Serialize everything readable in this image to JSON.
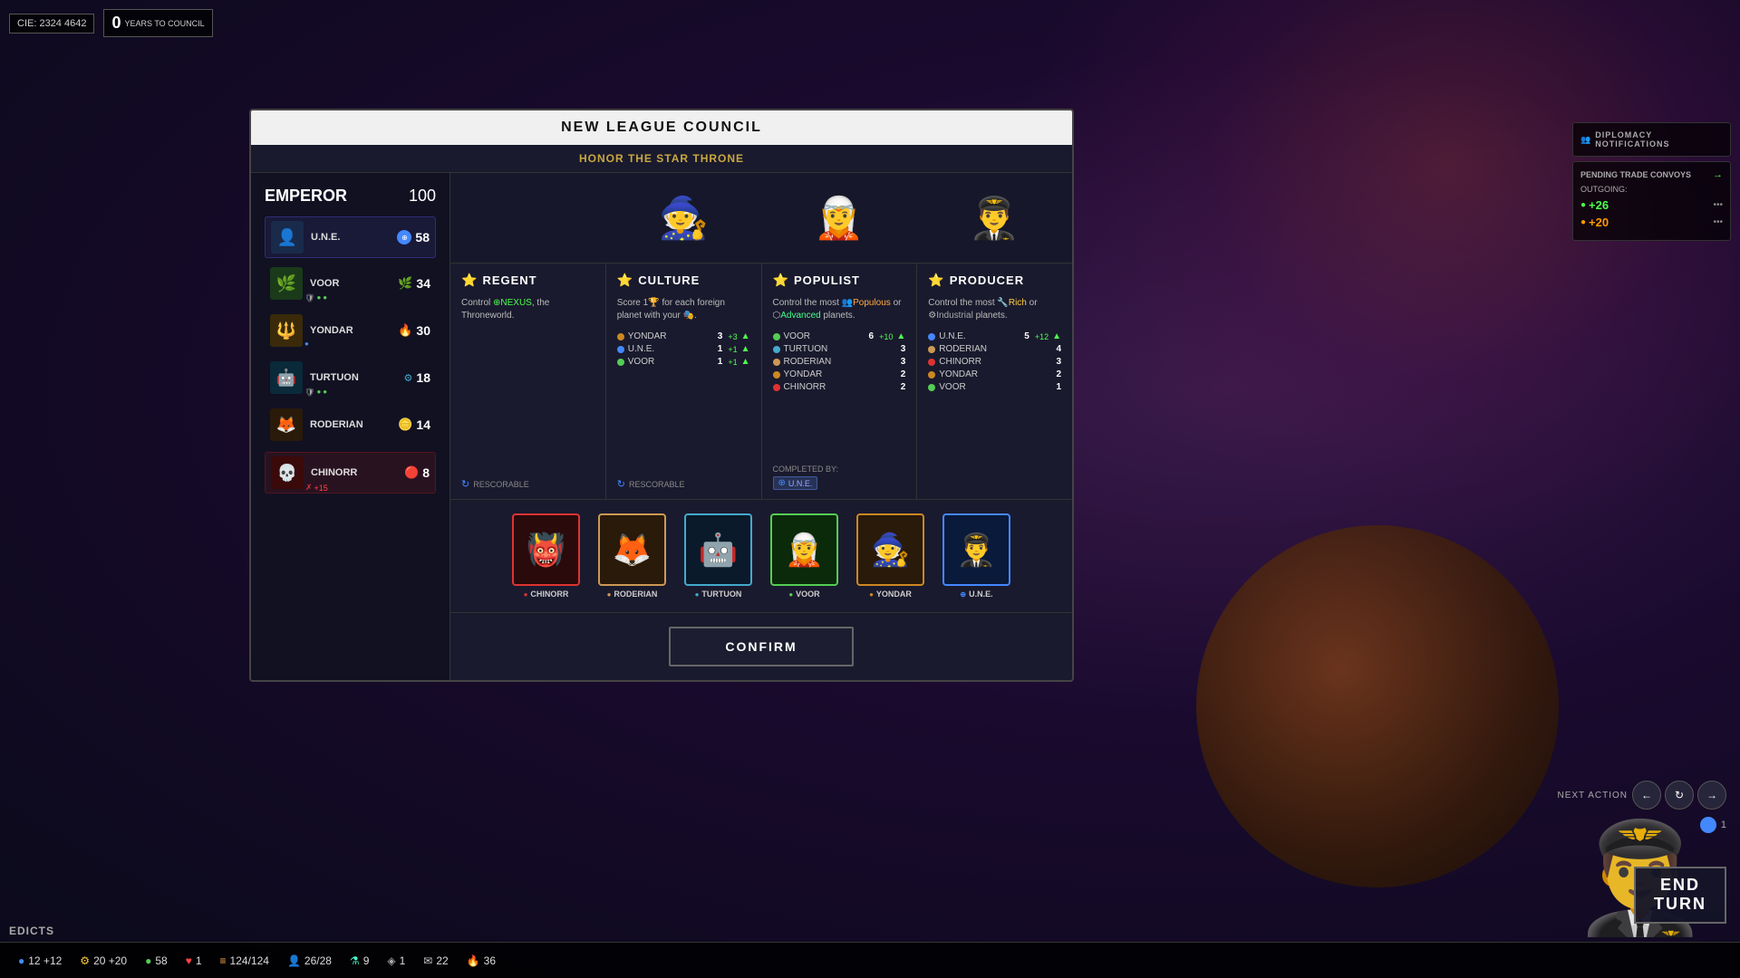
{
  "topbar": {
    "cie": "CIE: 2324 4642",
    "years": "0",
    "years_label": "YEARS TO COUNCIL"
  },
  "modal": {
    "title": "NEW LEAGUE COUNCIL",
    "subtitle": "HONOR THE STAR THRONE",
    "emperor": {
      "label": "EMPEROR",
      "points": 100,
      "factions": [
        {
          "name": "U.N.E.",
          "score": 58,
          "color": "#4488ff",
          "icons": [
            "circle",
            "circle"
          ],
          "highlight": true
        },
        {
          "name": "VOOR",
          "score": 34,
          "color": "#55cc55",
          "icons": [
            "shield",
            "circle",
            "circle"
          ],
          "highlight": false
        },
        {
          "name": "YONDAR",
          "score": 30,
          "color": "#cc8822",
          "icons": [],
          "highlight": false
        },
        {
          "name": "TURTUON",
          "score": 18,
          "color": "#44aacc",
          "icons": [
            "shield",
            "circle",
            "circle"
          ],
          "highlight": false
        },
        {
          "name": "RODERIAN",
          "score": 14,
          "color": "#cc9955",
          "icons": [],
          "highlight": false
        },
        {
          "name": "CHINORR",
          "score": 8,
          "color": "#dd3333",
          "icons": [
            "x_plus"
          ],
          "highlight": false
        }
      ]
    },
    "roles": [
      {
        "id": "regent",
        "name": "REGENT",
        "desc": "Control ⊕NEXUS, the Throneworld.",
        "scores": [],
        "rescorable": true,
        "completed_by": null
      },
      {
        "id": "culture",
        "name": "CULTURE",
        "desc": "Score 1🏆 for each foreign planet with your 🎭.",
        "scores": [
          {
            "name": "YONDAR",
            "val": 3,
            "bonus": "+3",
            "color": "#cc8822"
          },
          {
            "name": "U.N.E.",
            "val": 1,
            "bonus": "+1",
            "color": "#4488ff"
          },
          {
            "name": "VOOR",
            "val": 1,
            "bonus": "+1",
            "color": "#55cc55"
          }
        ],
        "rescorable": true,
        "completed_by": null
      },
      {
        "id": "populist",
        "name": "POPULIST",
        "desc": "Control the most 👥Populous or ⬡Advanced planets.",
        "scores": [
          {
            "name": "VOOR",
            "val": 6,
            "bonus": "+10",
            "color": "#55cc55"
          },
          {
            "name": "TURTUON",
            "val": 3,
            "bonus": "",
            "color": "#44aacc"
          },
          {
            "name": "RODERIAN",
            "val": 3,
            "bonus": "",
            "color": "#cc9955"
          },
          {
            "name": "YONDAR",
            "val": 2,
            "bonus": "",
            "color": "#cc8822"
          },
          {
            "name": "CHINORR",
            "val": 2,
            "bonus": "",
            "color": "#dd3333"
          }
        ],
        "rescorable": false,
        "completed_by": "U.N.E."
      },
      {
        "id": "producer",
        "name": "PRODUCER",
        "desc": "Control the most 🔧Rich or ⚙Industrial planets.",
        "scores": [
          {
            "name": "U.N.E.",
            "val": 5,
            "bonus": "+12",
            "color": "#4488ff"
          },
          {
            "name": "RODERIAN",
            "val": 4,
            "bonus": "",
            "color": "#cc9955"
          },
          {
            "name": "CHINORR",
            "val": 3,
            "bonus": "",
            "color": "#dd3333"
          },
          {
            "name": "YONDAR",
            "val": 2,
            "bonus": "",
            "color": "#cc8822"
          },
          {
            "name": "VOOR",
            "val": 1,
            "bonus": "",
            "color": "#55cc55"
          }
        ],
        "rescorable": false,
        "completed_by": null
      }
    ],
    "faction_portraits": [
      {
        "name": "CHINORR",
        "color": "#dd3333",
        "selected": false,
        "emoji": "👹"
      },
      {
        "name": "RODERIAN",
        "color": "#cc9955",
        "selected": false,
        "emoji": "🦊"
      },
      {
        "name": "TURTUON",
        "color": "#44aacc",
        "selected": false,
        "emoji": "🤖"
      },
      {
        "name": "VOOR",
        "color": "#55cc55",
        "selected": false,
        "emoji": "🧝"
      },
      {
        "name": "YONDAR",
        "color": "#cc8822",
        "selected": false,
        "emoji": "🧙"
      },
      {
        "name": "U.N.E.",
        "color": "#4488ff",
        "selected": true,
        "emoji": "👨‍✈️"
      }
    ],
    "confirm_label": "CONFIRM"
  },
  "right_panel": {
    "diplomacy_label": "DIPLOMACY NOTIFICATIONS",
    "trade_label": "PENDING TRADE CONVOYS",
    "outgoing_label": "OUTGOING:",
    "trade1": "+26",
    "trade2": "+20"
  },
  "bottom_bar": {
    "edicts_label": "EDICTS",
    "resources": [
      {
        "icon": "🔵",
        "val": "12 +12"
      },
      {
        "icon": "⚙️",
        "val": "20 +20"
      },
      {
        "icon": "💚",
        "val": "58"
      },
      {
        "icon": "❤️",
        "val": "1"
      },
      {
        "icon": "🟡",
        "val": "124/124"
      },
      {
        "icon": "🔵",
        "val": "26/28"
      },
      {
        "icon": "⚙️",
        "val": "9"
      },
      {
        "icon": "⚪",
        "val": "1"
      },
      {
        "icon": "✉️",
        "val": "22"
      },
      {
        "icon": "🔥",
        "val": "36"
      }
    ]
  },
  "end_turn": {
    "next_action_label": "NEXT ACTION",
    "end_turn_label": "END\nTURN",
    "counter": "1"
  }
}
